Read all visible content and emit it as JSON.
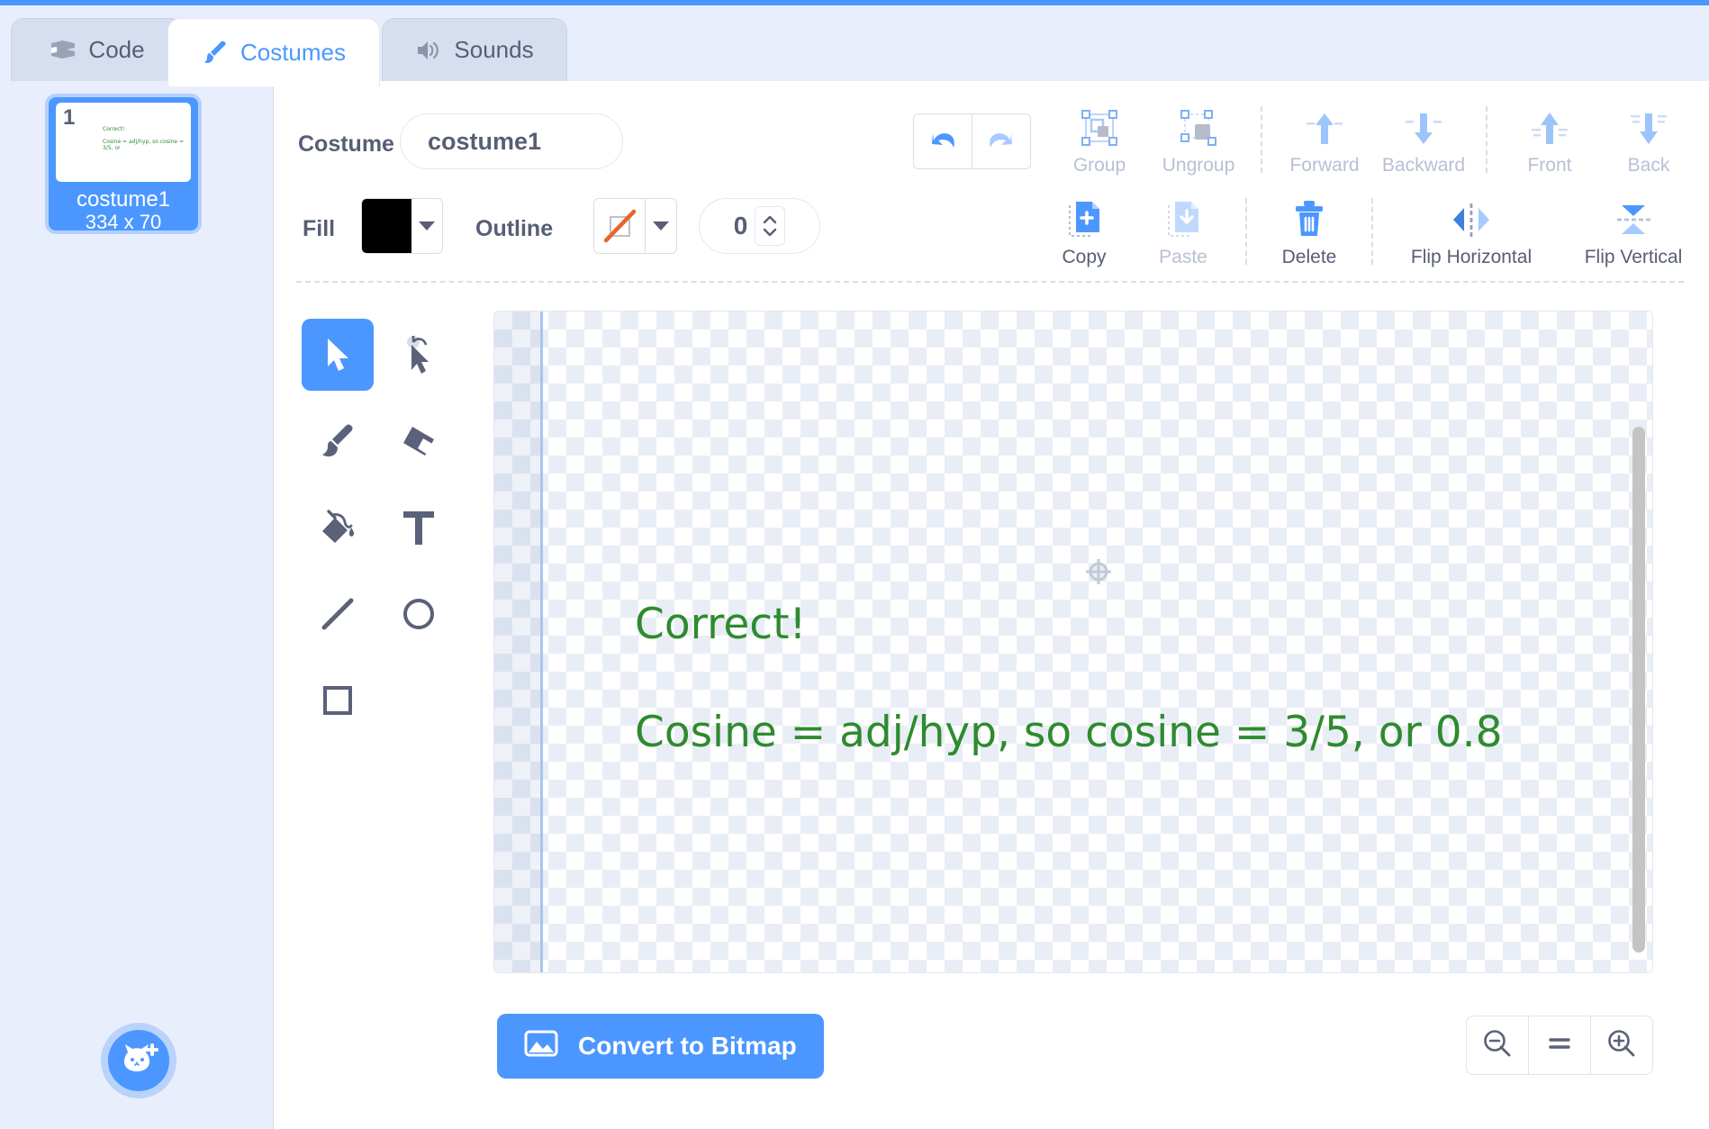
{
  "app": {
    "accent_color": "#4c97ff",
    "text_color": "#575e75",
    "disabled_color": "#b9c0d4"
  },
  "tabs": [
    {
      "label": "Code",
      "icon": "code-blocks-icon",
      "active": false
    },
    {
      "label": "Costumes",
      "icon": "paintbrush-icon",
      "active": true
    },
    {
      "label": "Sounds",
      "icon": "speaker-icon",
      "active": false
    }
  ],
  "costume_list": {
    "items": [
      {
        "index": "1",
        "name": "costume1",
        "size": "334 x 70",
        "thumb_line1": "Correct!",
        "thumb_line2": "Cosine = adj/hyp, so cosine = 3/5, or",
        "selected": true
      }
    ],
    "add_button_icon": "add-costume-cat-icon"
  },
  "toolbar": {
    "costume_label": "Costume",
    "costume_name_value": "costume1",
    "costume_name_placeholder": "costume1",
    "undo_icon": "undo-arrow-icon",
    "redo_icon": "redo-arrow-icon",
    "fill_label": "Fill",
    "fill_color": "#000000",
    "outline_label": "Outline",
    "outline_color": "none",
    "stroke_width": "0",
    "arrange": [
      {
        "label": "Group",
        "icon": "group-icon",
        "enabled": false
      },
      {
        "label": "Ungroup",
        "icon": "ungroup-icon",
        "enabled": false
      },
      {
        "label": "Forward",
        "icon": "forward-arrow-icon",
        "enabled": false
      },
      {
        "label": "Backward",
        "icon": "backward-arrow-icon",
        "enabled": false
      },
      {
        "label": "Front",
        "icon": "front-arrow-icon",
        "enabled": false
      },
      {
        "label": "Back",
        "icon": "back-arrow-icon",
        "enabled": false
      }
    ],
    "edit": [
      {
        "label": "Copy",
        "icon": "copy-icon",
        "enabled": true
      },
      {
        "label": "Paste",
        "icon": "paste-icon",
        "enabled": false
      },
      {
        "label": "Delete",
        "icon": "trash-icon",
        "enabled": true
      },
      {
        "label": "Flip Horizontal",
        "icon": "flip-horizontal-icon",
        "enabled": true
      },
      {
        "label": "Flip Vertical",
        "icon": "flip-vertical-icon",
        "enabled": true
      }
    ]
  },
  "tools": [
    {
      "name": "Select",
      "icon": "select-arrow-icon",
      "active": true
    },
    {
      "name": "Reshape",
      "icon": "reshape-icon",
      "active": false
    },
    {
      "name": "Brush",
      "icon": "brush-icon",
      "active": false
    },
    {
      "name": "Eraser",
      "icon": "eraser-icon",
      "active": false
    },
    {
      "name": "Fill",
      "icon": "paint-bucket-icon",
      "active": false
    },
    {
      "name": "Text",
      "icon": "text-tool-icon",
      "active": false
    },
    {
      "name": "Line",
      "icon": "line-icon",
      "active": false
    },
    {
      "name": "Circle",
      "icon": "circle-icon",
      "active": false
    },
    {
      "name": "Rectangle",
      "icon": "rectangle-icon",
      "active": false
    }
  ],
  "canvas": {
    "center_icon": "crosshair-icon",
    "text_color": "#2e8b2e",
    "lines": [
      "Correct!",
      "Cosine = adj/hyp, so cosine = 3/5, or 0.8"
    ]
  },
  "footer": {
    "convert_label": "Convert to Bitmap",
    "convert_icon": "image-icon",
    "zoom_out_icon": "zoom-out-icon",
    "zoom_reset_icon": "zoom-reset-icon",
    "zoom_in_icon": "zoom-in-icon"
  }
}
